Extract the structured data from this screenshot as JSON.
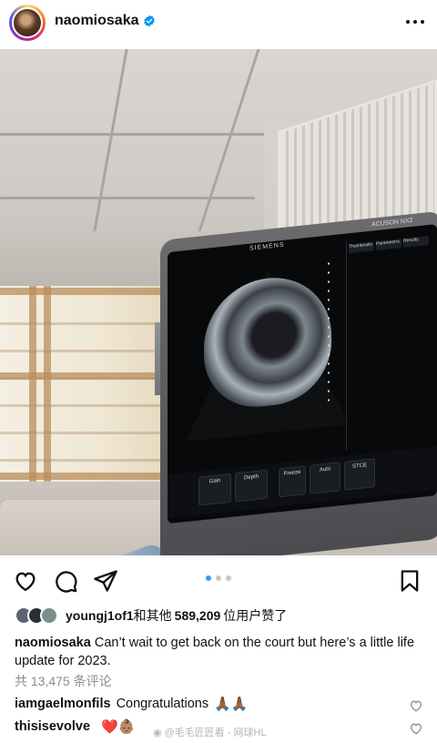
{
  "header": {
    "username": "naomiosaka",
    "verified_icon": "verified-badge-icon",
    "more_icon": "more-options-icon"
  },
  "photo": {
    "monitor_brand": "SIEMENS",
    "monitor_model": "ACUSON NX2",
    "screen_tabs": [
      "Thumbnails",
      "Parameters",
      "Results"
    ],
    "controls": [
      "Gain",
      "Depth",
      "Freeze",
      "Auto",
      "STCE"
    ]
  },
  "carousel": {
    "dots": 3,
    "active_index": 0
  },
  "actions": [
    "heart-icon",
    "comment-icon",
    "share-icon",
    "save-icon"
  ],
  "likes": {
    "liker": "youngj1of1",
    "text_mid": "和其他",
    "count": "589,209",
    "text_end": "位用户赞了"
  },
  "caption": {
    "author": "naomiosaka",
    "text": "Can’t wait to get back on the court but here’s a little life update for 2023."
  },
  "comments_summary": "共 13,475 条评论",
  "comments": [
    {
      "author": "iamgaelmonfils",
      "text": "Congratulations",
      "emoji": "🙏🏾🙏🏾"
    },
    {
      "author": "thisisevolve",
      "text": "",
      "emoji": "❤️👶🏽"
    }
  ],
  "watermark": "@毛毛匠匠看 - 网球HL",
  "colors": {
    "accent": "#3797f0",
    "verified": "#0095f6",
    "muted": "#8e8e8e"
  }
}
